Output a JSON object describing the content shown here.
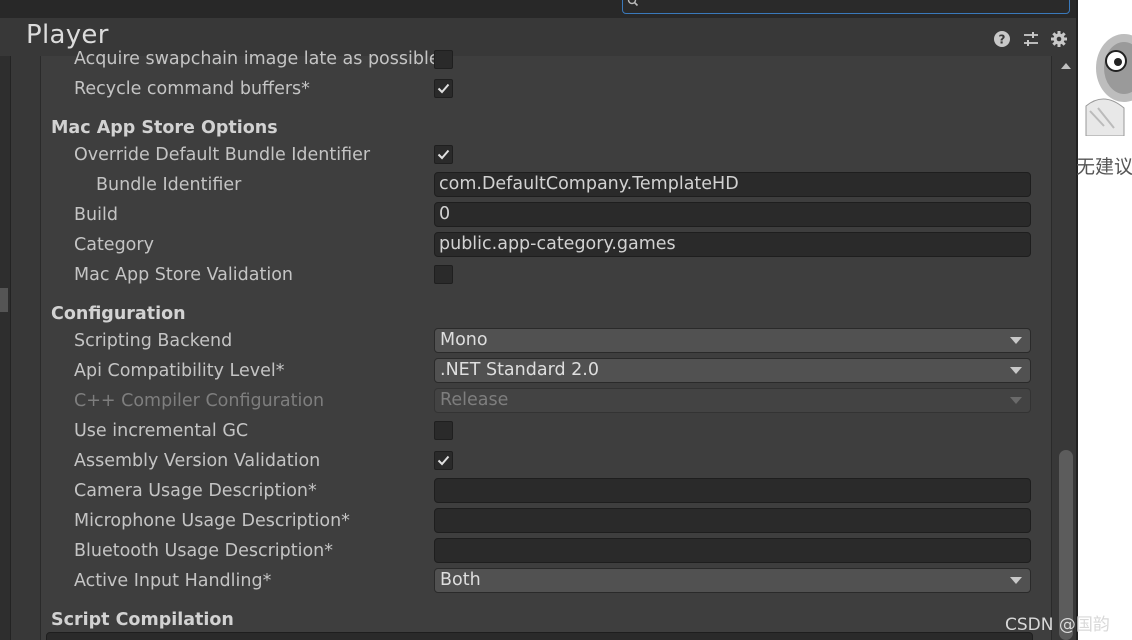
{
  "window": {
    "title": "Player"
  },
  "search": {
    "value": ""
  },
  "header_icons": [
    "help-icon",
    "preset-sliders-icon",
    "gear-icon"
  ],
  "rows": {
    "acquire": {
      "label": "Acquire swapchain image late as possible",
      "checked": false
    },
    "recycle": {
      "label": "Recycle command buffers*",
      "checked": true
    }
  },
  "mac_app_store": {
    "heading": "Mac App Store Options",
    "override_bundle": {
      "label": "Override Default Bundle Identifier",
      "checked": true
    },
    "bundle_identifier": {
      "label": "Bundle Identifier",
      "value": "com.DefaultCompany.TemplateHD"
    },
    "build": {
      "label": "Build",
      "value": "0"
    },
    "category": {
      "label": "Category",
      "value": "public.app-category.games"
    },
    "validation": {
      "label": "Mac App Store Validation",
      "checked": false
    }
  },
  "configuration": {
    "heading": "Configuration",
    "scripting_backend": {
      "label": "Scripting Backend",
      "value": "Mono"
    },
    "api_compat": {
      "label": "Api Compatibility Level*",
      "value": ".NET Standard 2.0"
    },
    "cpp_compiler": {
      "label": "C++ Compiler Configuration",
      "value": "Release",
      "disabled": true
    },
    "incremental_gc": {
      "label": "Use incremental GC",
      "checked": false
    },
    "assembly_validation": {
      "label": "Assembly Version Validation",
      "checked": true
    },
    "camera_usage": {
      "label": "Camera Usage Description*",
      "value": ""
    },
    "microphone_usage": {
      "label": "Microphone Usage Description*",
      "value": ""
    },
    "bluetooth_usage": {
      "label": "Bluetooth Usage Description*",
      "value": ""
    },
    "input_handling": {
      "label": "Active Input Handling*",
      "value": "Both"
    }
  },
  "script_compilation": {
    "heading": "Script Compilation"
  },
  "side_panel": {
    "text": "无建议"
  },
  "watermark": {
    "text": "CSDN @国韵"
  },
  "colors": {
    "accent": "#3a79bb",
    "panel": "#3e3e3e",
    "field": "#2a2a2a"
  }
}
